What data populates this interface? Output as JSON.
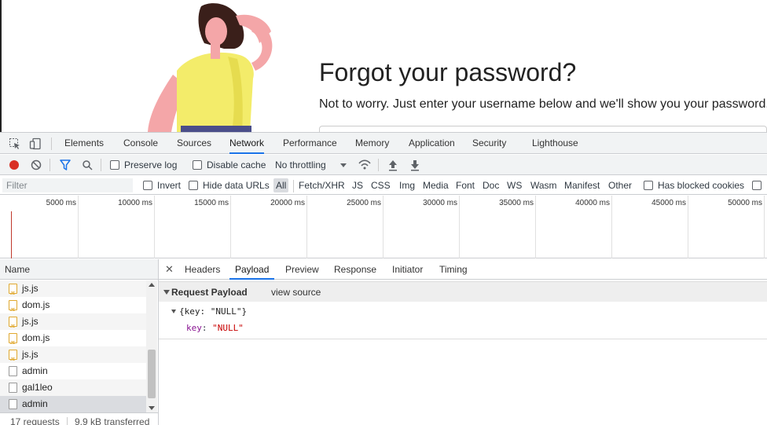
{
  "page": {
    "title": "Forgot your password?",
    "subtitle": "Not to worry. Just enter your username below and we'll show you your password."
  },
  "devtools": {
    "tabs": [
      "Elements",
      "Console",
      "Sources",
      "Network",
      "Performance",
      "Memory",
      "Application",
      "Security",
      "Lighthouse"
    ],
    "active_tab": "Network",
    "toolbar": {
      "preserve_log": "Preserve log",
      "disable_cache": "Disable cache",
      "throttling": "No throttling"
    },
    "filter": {
      "placeholder": "Filter",
      "invert": "Invert",
      "hide_data_urls": "Hide data URLs",
      "types": [
        "All",
        "Fetch/XHR",
        "JS",
        "CSS",
        "Img",
        "Media",
        "Font",
        "Doc",
        "WS",
        "Wasm",
        "Manifest",
        "Other"
      ],
      "has_blocked_cookies": "Has blocked cookies"
    },
    "timeline_labels": [
      "5000 ms",
      "10000 ms",
      "15000 ms",
      "20000 ms",
      "25000 ms",
      "30000 ms",
      "35000 ms",
      "40000 ms",
      "45000 ms",
      "50000 ms"
    ],
    "requests": {
      "header": "Name",
      "rows": [
        {
          "name": "js.js",
          "type": "js"
        },
        {
          "name": "dom.js",
          "type": "js"
        },
        {
          "name": "js.js",
          "type": "js"
        },
        {
          "name": "dom.js",
          "type": "js"
        },
        {
          "name": "js.js",
          "type": "js"
        },
        {
          "name": "admin",
          "type": "doc"
        },
        {
          "name": "gal1leo",
          "type": "doc"
        },
        {
          "name": "admin",
          "type": "doc"
        }
      ],
      "status_count": "17 requests",
      "status_transferred": "9.9 kB transferred"
    },
    "detail_tabs": [
      "Headers",
      "Payload",
      "Preview",
      "Response",
      "Initiator",
      "Timing"
    ],
    "active_detail_tab": "Payload",
    "payload": {
      "section_title": "Request Payload",
      "view_source": "view source",
      "summary": "{key: \"NULL\"}",
      "key": "key",
      "value": "\"NULL\""
    }
  },
  "colors": {
    "accent": "#1a73e8",
    "record": "#d93025",
    "payload_key": "#881391",
    "payload_value": "#c80000"
  }
}
